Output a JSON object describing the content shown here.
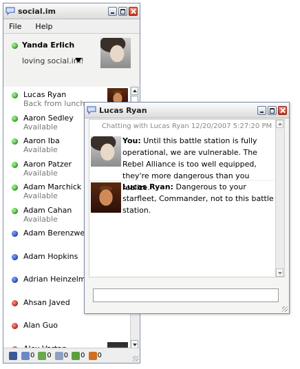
{
  "main_window": {
    "title": "social.im",
    "menu": [
      "File",
      "Help"
    ],
    "profile": {
      "name": "Yanda Erlich",
      "status_text": "loving social.im!",
      "status_color": "green"
    },
    "contacts": [
      {
        "name": "Lucas Ryan",
        "status": "Back from lunch",
        "status_color": "green",
        "has_photo": true
      },
      {
        "name": "Aaron Sedley",
        "status": "Available",
        "status_color": "green"
      },
      {
        "name": "Aaron Iba",
        "status": "Available",
        "status_color": "green"
      },
      {
        "name": "Aaron Patzer",
        "status": "Available",
        "status_color": "green"
      },
      {
        "name": "Adam Marchick",
        "status": "Available",
        "status_color": "green"
      },
      {
        "name": "Adam Cahan",
        "status": "Available",
        "status_color": "green"
      },
      {
        "name": "Adam Berenzweig",
        "status": "",
        "status_color": "blue"
      },
      {
        "name": "Adam Hopkins",
        "status": "",
        "status_color": "blue"
      },
      {
        "name": "Adrian Heinzelman",
        "status": "",
        "status_color": "blue"
      },
      {
        "name": "Ahsan Javed",
        "status": "",
        "status_color": "red"
      },
      {
        "name": "Alan Guo",
        "status": "",
        "status_color": "red"
      },
      {
        "name": "Alex Vartan",
        "status": "",
        "status_color": "red",
        "has_photo": true
      }
    ],
    "bottom_bar": [
      {
        "icon": "facebook-icon",
        "count": ""
      },
      {
        "icon": "feed-icon",
        "count": "0"
      },
      {
        "icon": "friends-icon",
        "count": "0"
      },
      {
        "icon": "mail-icon",
        "count": "0"
      },
      {
        "icon": "sms-icon",
        "count": "0"
      },
      {
        "icon": "photos-icon",
        "count": "0"
      }
    ]
  },
  "chat_window": {
    "title": "Lucas Ryan",
    "header": "Chatting with Lucas Ryan 12/20/2007 5:27:20 PM",
    "messages": [
      {
        "sender": "You:",
        "text": "Until this battle station is fully operational, we are vulnerable. The Rebel Alliance is too well equipped, they're more dangerous than you realize."
      },
      {
        "sender": "Lucas Ryan:",
        "text": "Dangerous to your starfleet, Commander, not to this battle station."
      }
    ],
    "input_value": ""
  },
  "colors": {
    "green": "#2fae20",
    "blue": "#1c3fbf",
    "red": "#c41a0a"
  }
}
